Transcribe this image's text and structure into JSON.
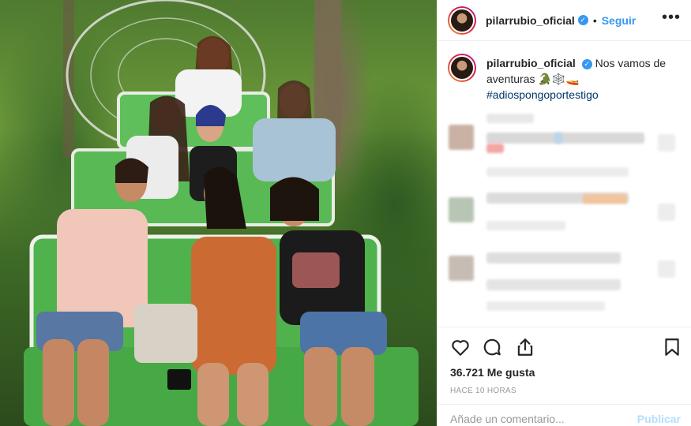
{
  "post": {
    "username": "pilarrubio_oficial",
    "verified_icon": "verified-badge-icon",
    "separator": "•",
    "follow_label": "Seguir",
    "more_icon": "more-options-icon"
  },
  "caption": {
    "username": "pilarrubio_oficial",
    "text": "Nos vamos de aventuras 🐊🕸️🚤",
    "hashtag": "#adiospongoportestigo"
  },
  "actions": {
    "like_icon": "heart-icon",
    "comment_icon": "comment-icon",
    "share_icon": "share-icon",
    "save_icon": "bookmark-icon",
    "likes_text": "36.721 Me gusta",
    "time_text": "HACE 10 HORAS"
  },
  "comment_box": {
    "placeholder": "Añade un comentario...",
    "publish_label": "Publicar"
  },
  "colors": {
    "accent": "#3897f0",
    "hashtag": "#003569",
    "muted": "#999999",
    "publish_disabled": "#b2dffc"
  }
}
